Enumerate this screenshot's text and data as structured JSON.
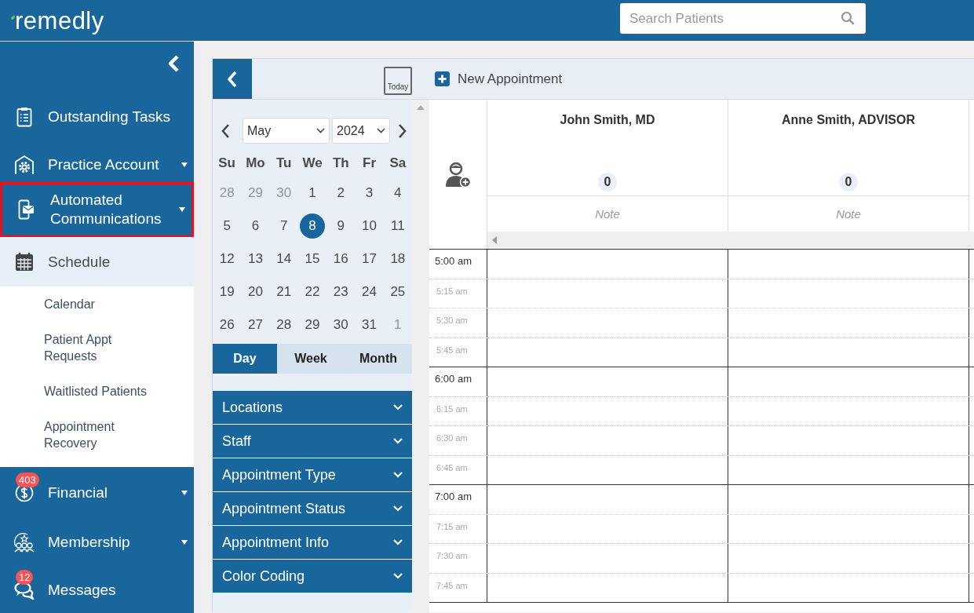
{
  "header": {
    "logo": "remedly",
    "search": {
      "placeholder": "Search Patients"
    }
  },
  "sidebar": {
    "items": [
      {
        "label": "Outstanding Tasks",
        "has_submenu": false,
        "expanded": false,
        "highlighted": false
      },
      {
        "label": "Practice Account",
        "has_submenu": true,
        "expanded": false,
        "highlighted": false
      },
      {
        "label": "Automated Communications",
        "has_submenu": true,
        "expanded": false,
        "highlighted": true
      },
      {
        "label": "Schedule",
        "has_submenu": false,
        "expanded": true,
        "highlighted": false,
        "children": [
          {
            "label": "Calendar"
          },
          {
            "label": "Patient Appt Requests"
          },
          {
            "label": "Waitlisted Patients"
          },
          {
            "label": "Appointment Recovery"
          }
        ]
      },
      {
        "label": "Financial",
        "has_submenu": true,
        "expanded": false,
        "highlighted": false,
        "badge": "403"
      },
      {
        "label": "Membership",
        "has_submenu": true,
        "expanded": false,
        "highlighted": false
      },
      {
        "label": "Messages",
        "has_submenu": false,
        "expanded": false,
        "highlighted": false,
        "badge": "12"
      }
    ]
  },
  "toolbar": {
    "today": "Today",
    "new_appointment": "New Appointment"
  },
  "mini_calendar": {
    "month": "May",
    "year": "2024",
    "weekdays": [
      "Su",
      "Mo",
      "Tu",
      "We",
      "Th",
      "Fr",
      "Sa"
    ],
    "days": [
      {
        "label": "28",
        "outside": true,
        "selected": false
      },
      {
        "label": "29",
        "outside": true,
        "selected": false
      },
      {
        "label": "30",
        "outside": true,
        "selected": false
      },
      {
        "label": "1",
        "outside": false,
        "selected": false
      },
      {
        "label": "2",
        "outside": false,
        "selected": false
      },
      {
        "label": "3",
        "outside": false,
        "selected": false
      },
      {
        "label": "4",
        "outside": false,
        "selected": false
      },
      {
        "label": "5",
        "outside": false,
        "selected": false
      },
      {
        "label": "6",
        "outside": false,
        "selected": false
      },
      {
        "label": "7",
        "outside": false,
        "selected": false
      },
      {
        "label": "8",
        "outside": false,
        "selected": true
      },
      {
        "label": "9",
        "outside": false,
        "selected": false
      },
      {
        "label": "10",
        "outside": false,
        "selected": false
      },
      {
        "label": "11",
        "outside": false,
        "selected": false
      },
      {
        "label": "12",
        "outside": false,
        "selected": false
      },
      {
        "label": "13",
        "outside": false,
        "selected": false
      },
      {
        "label": "14",
        "outside": false,
        "selected": false
      },
      {
        "label": "15",
        "outside": false,
        "selected": false
      },
      {
        "label": "16",
        "outside": false,
        "selected": false
      },
      {
        "label": "17",
        "outside": false,
        "selected": false
      },
      {
        "label": "18",
        "outside": false,
        "selected": false
      },
      {
        "label": "19",
        "outside": false,
        "selected": false
      },
      {
        "label": "20",
        "outside": false,
        "selected": false
      },
      {
        "label": "21",
        "outside": false,
        "selected": false
      },
      {
        "label": "22",
        "outside": false,
        "selected": false
      },
      {
        "label": "23",
        "outside": false,
        "selected": false
      },
      {
        "label": "24",
        "outside": false,
        "selected": false
      },
      {
        "label": "25",
        "outside": false,
        "selected": false
      },
      {
        "label": "26",
        "outside": false,
        "selected": false
      },
      {
        "label": "27",
        "outside": false,
        "selected": false
      },
      {
        "label": "28",
        "outside": false,
        "selected": false
      },
      {
        "label": "29",
        "outside": false,
        "selected": false
      },
      {
        "label": "30",
        "outside": false,
        "selected": false
      },
      {
        "label": "31",
        "outside": false,
        "selected": false
      },
      {
        "label": "1",
        "outside": true,
        "selected": false
      }
    ],
    "view_tabs": [
      {
        "label": "Day",
        "selected": true
      },
      {
        "label": "Week",
        "selected": false
      },
      {
        "label": "Month",
        "selected": false
      }
    ]
  },
  "filters": [
    {
      "label": "Locations"
    },
    {
      "label": "Staff"
    },
    {
      "label": "Appointment Type"
    },
    {
      "label": "Appointment Status"
    },
    {
      "label": "Appointment Info"
    },
    {
      "label": "Color Coding"
    }
  ],
  "schedule": {
    "providers": [
      {
        "name": "John Smith, MD",
        "count": "0",
        "note_placeholder": "Note"
      },
      {
        "name": "Anne Smith, ADVISOR",
        "count": "0",
        "note_placeholder": "Note"
      }
    ],
    "times": [
      {
        "label": "5:00 am",
        "kind": "hour"
      },
      {
        "label": "5:15 am",
        "kind": "quarter"
      },
      {
        "label": "5:30 am",
        "kind": "quarter"
      },
      {
        "label": "5:45 am",
        "kind": "quarter"
      },
      {
        "label": "6:00 am",
        "kind": "hour"
      },
      {
        "label": "6:15 am",
        "kind": "quarter"
      },
      {
        "label": "6:30 am",
        "kind": "quarter"
      },
      {
        "label": "6:45 am",
        "kind": "quarter"
      },
      {
        "label": "7:00 am",
        "kind": "hour"
      },
      {
        "label": "7:15 am",
        "kind": "quarter"
      },
      {
        "label": "7:30 am",
        "kind": "quarter"
      },
      {
        "label": "7:45 am",
        "kind": "quarter"
      }
    ]
  }
}
